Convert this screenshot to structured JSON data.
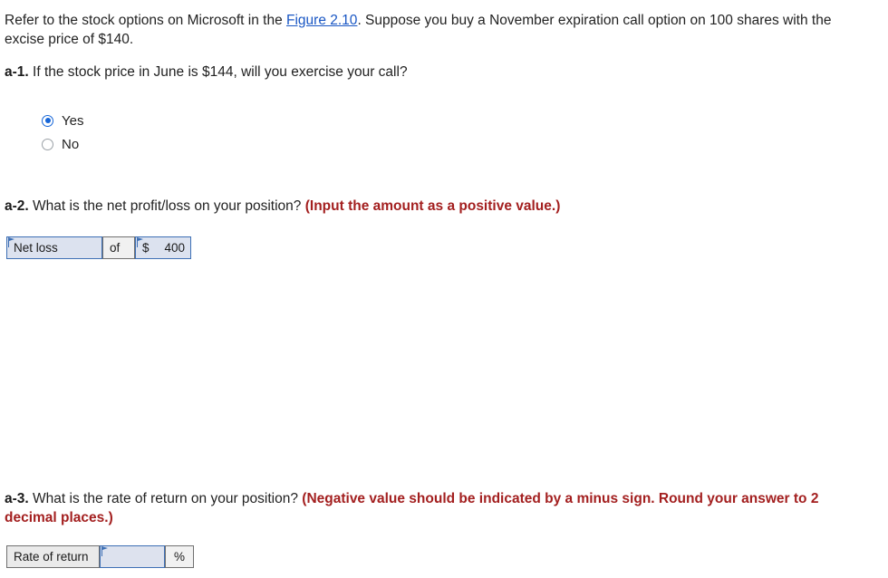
{
  "intro": {
    "text_before_link": "Refer to the stock options on Microsoft in the ",
    "link_text": "Figure 2.10",
    "text_after_link": ". Suppose you buy a November expiration call option on 100 shares with the excise price of $140."
  },
  "questions": {
    "a1": {
      "label": "a-1.",
      "text": "If the stock price in June is $144, will you exercise your call?",
      "options": [
        {
          "label": "Yes",
          "selected": true
        },
        {
          "label": "No",
          "selected": false
        }
      ]
    },
    "a2": {
      "label": "a-2.",
      "text": "What is the net profit/loss on your position?",
      "instruction": "(Input the amount as a positive value.)",
      "answer": {
        "select_value": "Net loss",
        "conjunction": "of",
        "currency_symbol": "$",
        "amount": "400"
      }
    },
    "a3": {
      "label": "a-3.",
      "text": "What is the rate of return on your position?",
      "instruction": "(Negative value should be indicated by a minus sign. Round your answer to 2 decimal places.)",
      "answer": {
        "row_label": "Rate of return",
        "value": "",
        "unit": "%"
      }
    }
  },
  "colors": {
    "link": "#1a57c4",
    "instruction_red": "#a31f1f",
    "input_border": "#3d6fb5",
    "input_fill": "#dce2ef",
    "radio_selected": "#1565d8",
    "static_cell_fill": "#eaeaea"
  }
}
